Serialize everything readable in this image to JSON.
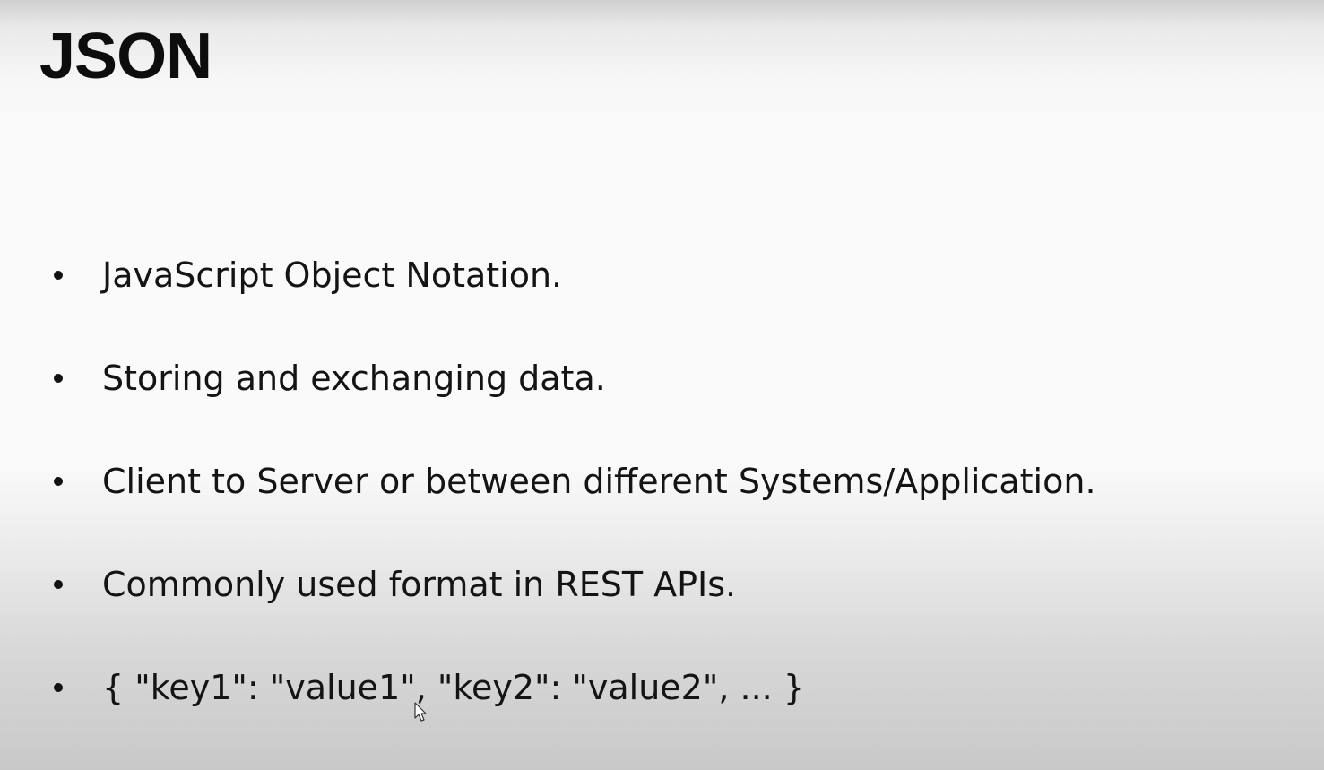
{
  "slide": {
    "title": "JSON",
    "bullets": [
      "JavaScript Object Notation.",
      "Storing and exchanging data.",
      "Client to Server or between different Systems/Application.",
      "Commonly used format in REST APIs.",
      "{ \"key1\": \"value1\", \"key2\": \"value2\", ... }"
    ]
  },
  "icons": {
    "cursor": "mouse-pointer-icon",
    "bullet": "bullet-dot-icon"
  },
  "colors": {
    "text": "#141414",
    "background_top": "#cfcfcf",
    "background_mid": "#fafafa",
    "background_bottom": "#c8c8c8"
  }
}
